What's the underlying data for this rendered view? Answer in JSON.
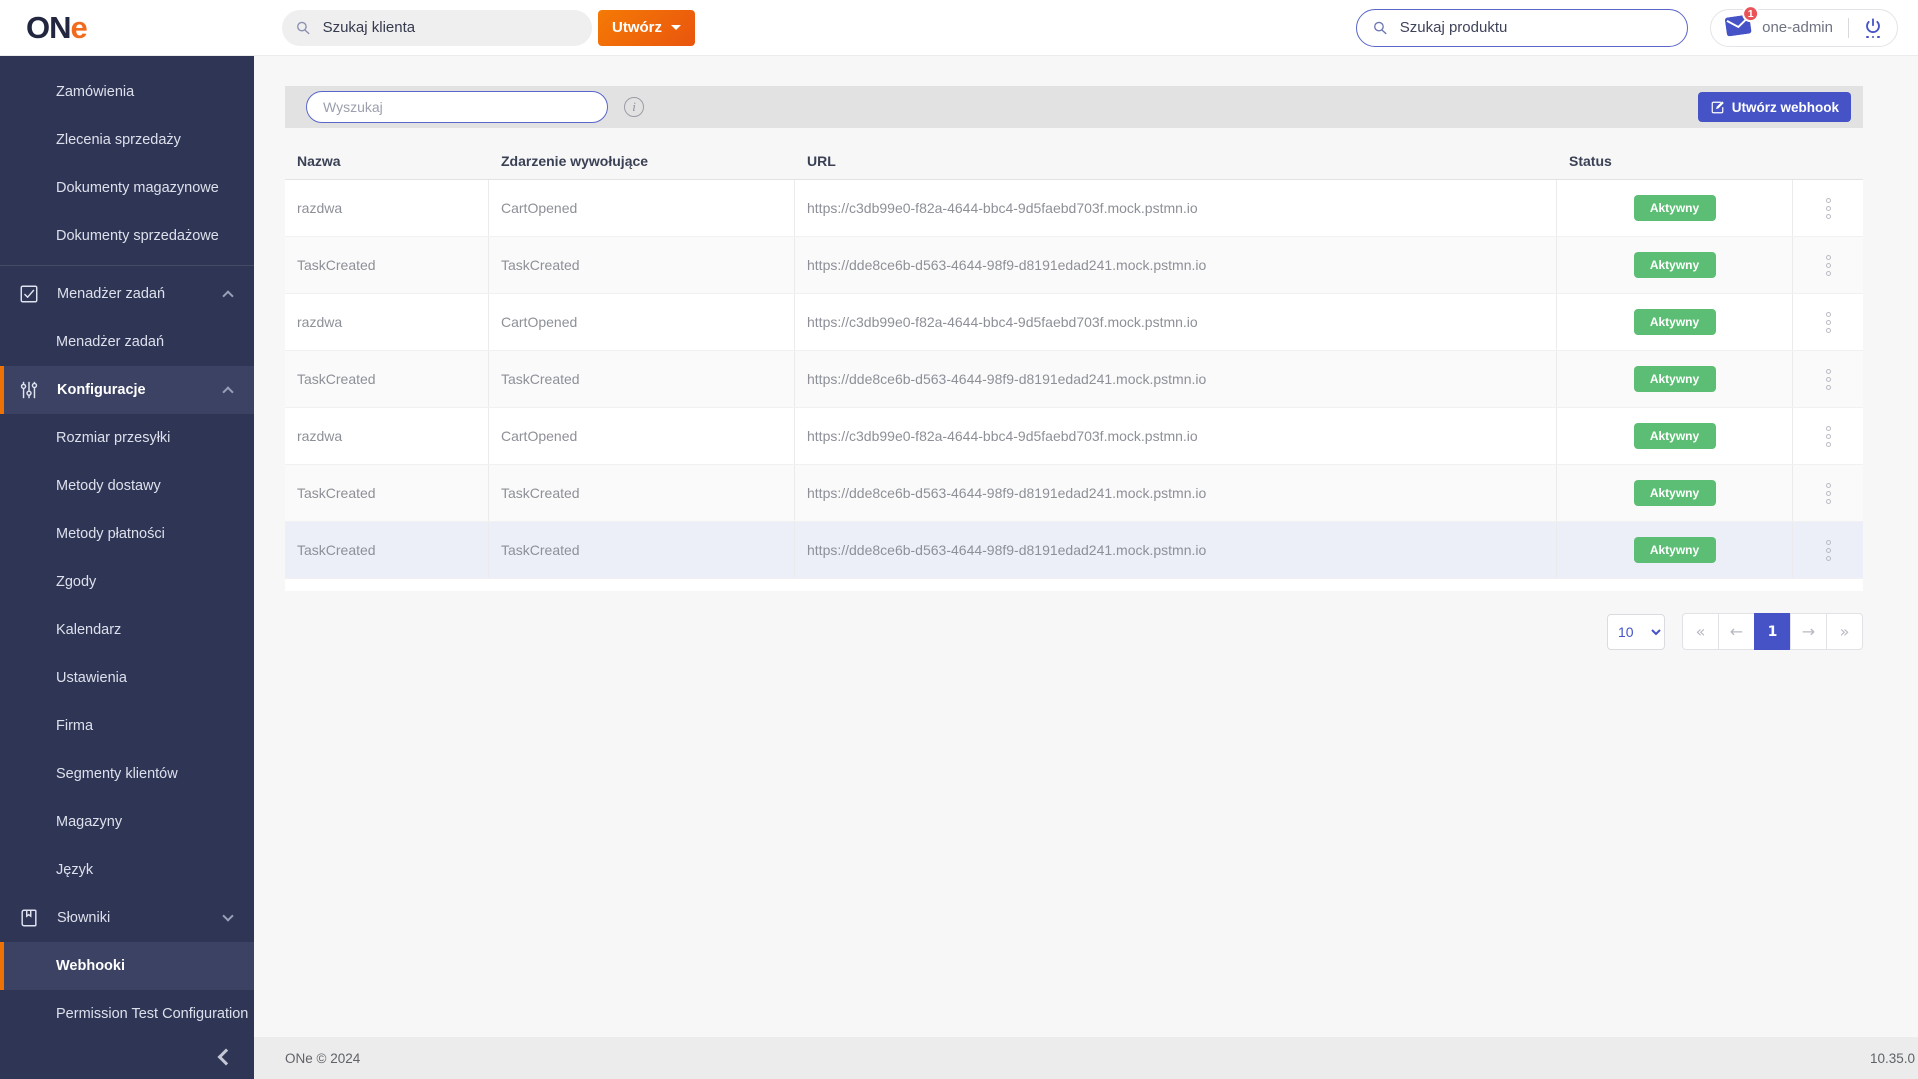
{
  "brand": {
    "logo_on": "ON",
    "logo_e": "e"
  },
  "topbar": {
    "search_client_placeholder": "Szukaj klienta",
    "create_button": "Utwórz",
    "search_product_placeholder": "Szukaj produktu",
    "notification_count": "1",
    "user_name": "one-admin"
  },
  "sidebar": {
    "items": [
      {
        "label": "Zamówienia",
        "type": "sub"
      },
      {
        "label": "Zlecenia sprzedaży",
        "type": "sub"
      },
      {
        "label": "Dokumenty magazynowe",
        "type": "sub"
      },
      {
        "label": "Dokumenty sprzedażowe",
        "type": "sub"
      },
      {
        "label": "Menadżer zadań",
        "type": "section",
        "icon": "tasks",
        "chevron": "up",
        "divider_above": true
      },
      {
        "label": "Menadżer zadań",
        "type": "sub"
      },
      {
        "label": "Konfiguracje",
        "type": "section",
        "icon": "sliders",
        "chevron": "up",
        "active": true
      },
      {
        "label": "Rozmiar przesyłki",
        "type": "sub"
      },
      {
        "label": "Metody dostawy",
        "type": "sub"
      },
      {
        "label": "Metody płatności",
        "type": "sub"
      },
      {
        "label": "Zgody",
        "type": "sub"
      },
      {
        "label": "Kalendarz",
        "type": "sub"
      },
      {
        "label": "Ustawienia",
        "type": "sub"
      },
      {
        "label": "Firma",
        "type": "sub"
      },
      {
        "label": "Segmenty klientów",
        "type": "sub"
      },
      {
        "label": "Magazyny",
        "type": "sub"
      },
      {
        "label": "Język",
        "type": "sub"
      },
      {
        "label": "Słowniki",
        "type": "section",
        "icon": "book",
        "chevron": "down"
      },
      {
        "label": "Webhooki",
        "type": "sub",
        "active": true
      },
      {
        "label": "Permission Test Configuration",
        "type": "sub"
      }
    ]
  },
  "toolbar": {
    "search_placeholder": "Wyszukaj",
    "info_icon_glyph": "i",
    "create_webhook_label": "Utwórz webhook"
  },
  "table": {
    "columns": {
      "name": "Nazwa",
      "event": "Zdarzenie wywołujące",
      "url": "URL",
      "status": "Status"
    },
    "rows": [
      {
        "name": "razdwa",
        "event": "CartOpened",
        "url": "https://c3db99e0-f82a-4644-bbc4-9d5faebd703f.mock.pstmn.io",
        "status": "Aktywny"
      },
      {
        "name": "TaskCreated",
        "event": "TaskCreated",
        "url": "https://dde8ce6b-d563-4644-98f9-d8191edad241.mock.pstmn.io",
        "status": "Aktywny",
        "variant": "alt"
      },
      {
        "name": "razdwa",
        "event": "CartOpened",
        "url": "https://c3db99e0-f82a-4644-bbc4-9d5faebd703f.mock.pstmn.io",
        "status": "Aktywny"
      },
      {
        "name": "TaskCreated",
        "event": "TaskCreated",
        "url": "https://dde8ce6b-d563-4644-98f9-d8191edad241.mock.pstmn.io",
        "status": "Aktywny",
        "variant": "alt"
      },
      {
        "name": "razdwa",
        "event": "CartOpened",
        "url": "https://c3db99e0-f82a-4644-bbc4-9d5faebd703f.mock.pstmn.io",
        "status": "Aktywny"
      },
      {
        "name": "TaskCreated",
        "event": "TaskCreated",
        "url": "https://dde8ce6b-d563-4644-98f9-d8191edad241.mock.pstmn.io",
        "status": "Aktywny",
        "variant": "alt"
      },
      {
        "name": "TaskCreated",
        "event": "TaskCreated",
        "url": "https://dde8ce6b-d563-4644-98f9-d8191edad241.mock.pstmn.io",
        "status": "Aktywny",
        "variant": "selected"
      }
    ]
  },
  "pagination": {
    "page_size": "10",
    "first": "«",
    "prev": "←",
    "current_page": "1",
    "next": "→",
    "last": "»"
  },
  "footer": {
    "copyright": "ONe © 2024",
    "version": "10.35.0"
  },
  "colors": {
    "accent_indigo": "#4553c6",
    "brand_orange": "#f26b1d",
    "active_border_orange": "#ee7203",
    "status_green": "#5cbe74",
    "sidebar_bg": "#2f3554",
    "notification_red": "#ea5459"
  }
}
